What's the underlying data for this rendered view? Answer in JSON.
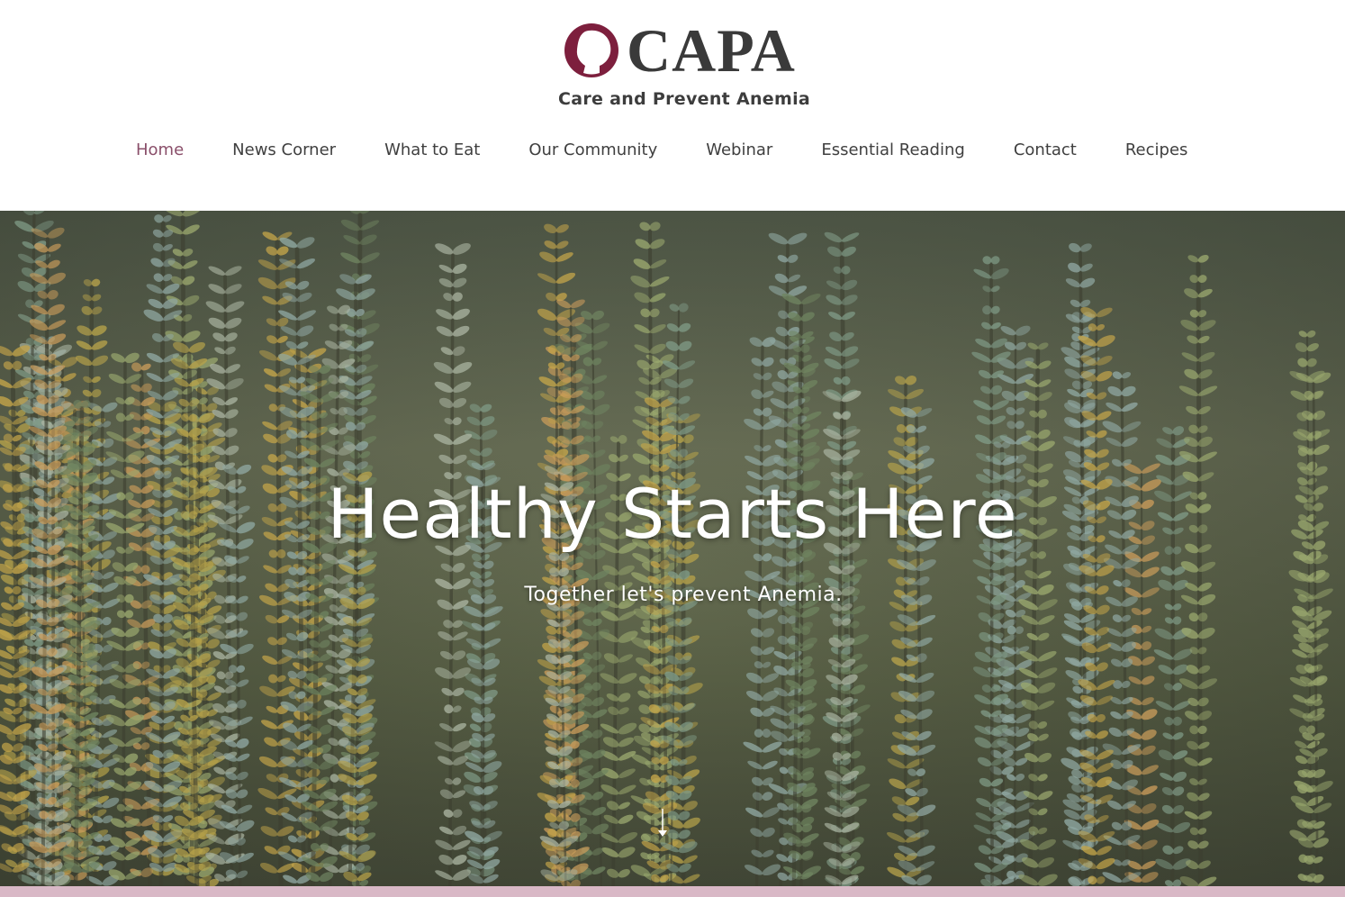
{
  "header": {
    "logo_text": "CAPA",
    "tagline": "Care and Prevent Anemia",
    "brand_color": "#7d1f3d"
  },
  "nav": {
    "items": [
      {
        "label": "Home",
        "active": true
      },
      {
        "label": "News Corner"
      },
      {
        "label": "What to Eat"
      },
      {
        "label": "Our Community"
      },
      {
        "label": "Webinar"
      },
      {
        "label": "Essential Reading"
      },
      {
        "label": "Contact"
      },
      {
        "label": "Recipes"
      }
    ],
    "active_color": "#8a4f6a"
  },
  "hero": {
    "title": "Healthy Starts Here",
    "subtitle": "Together let's prevent Anemia.",
    "scroll_icon": "arrow-down-icon"
  },
  "footer_strip_color": "#d9b8c6"
}
